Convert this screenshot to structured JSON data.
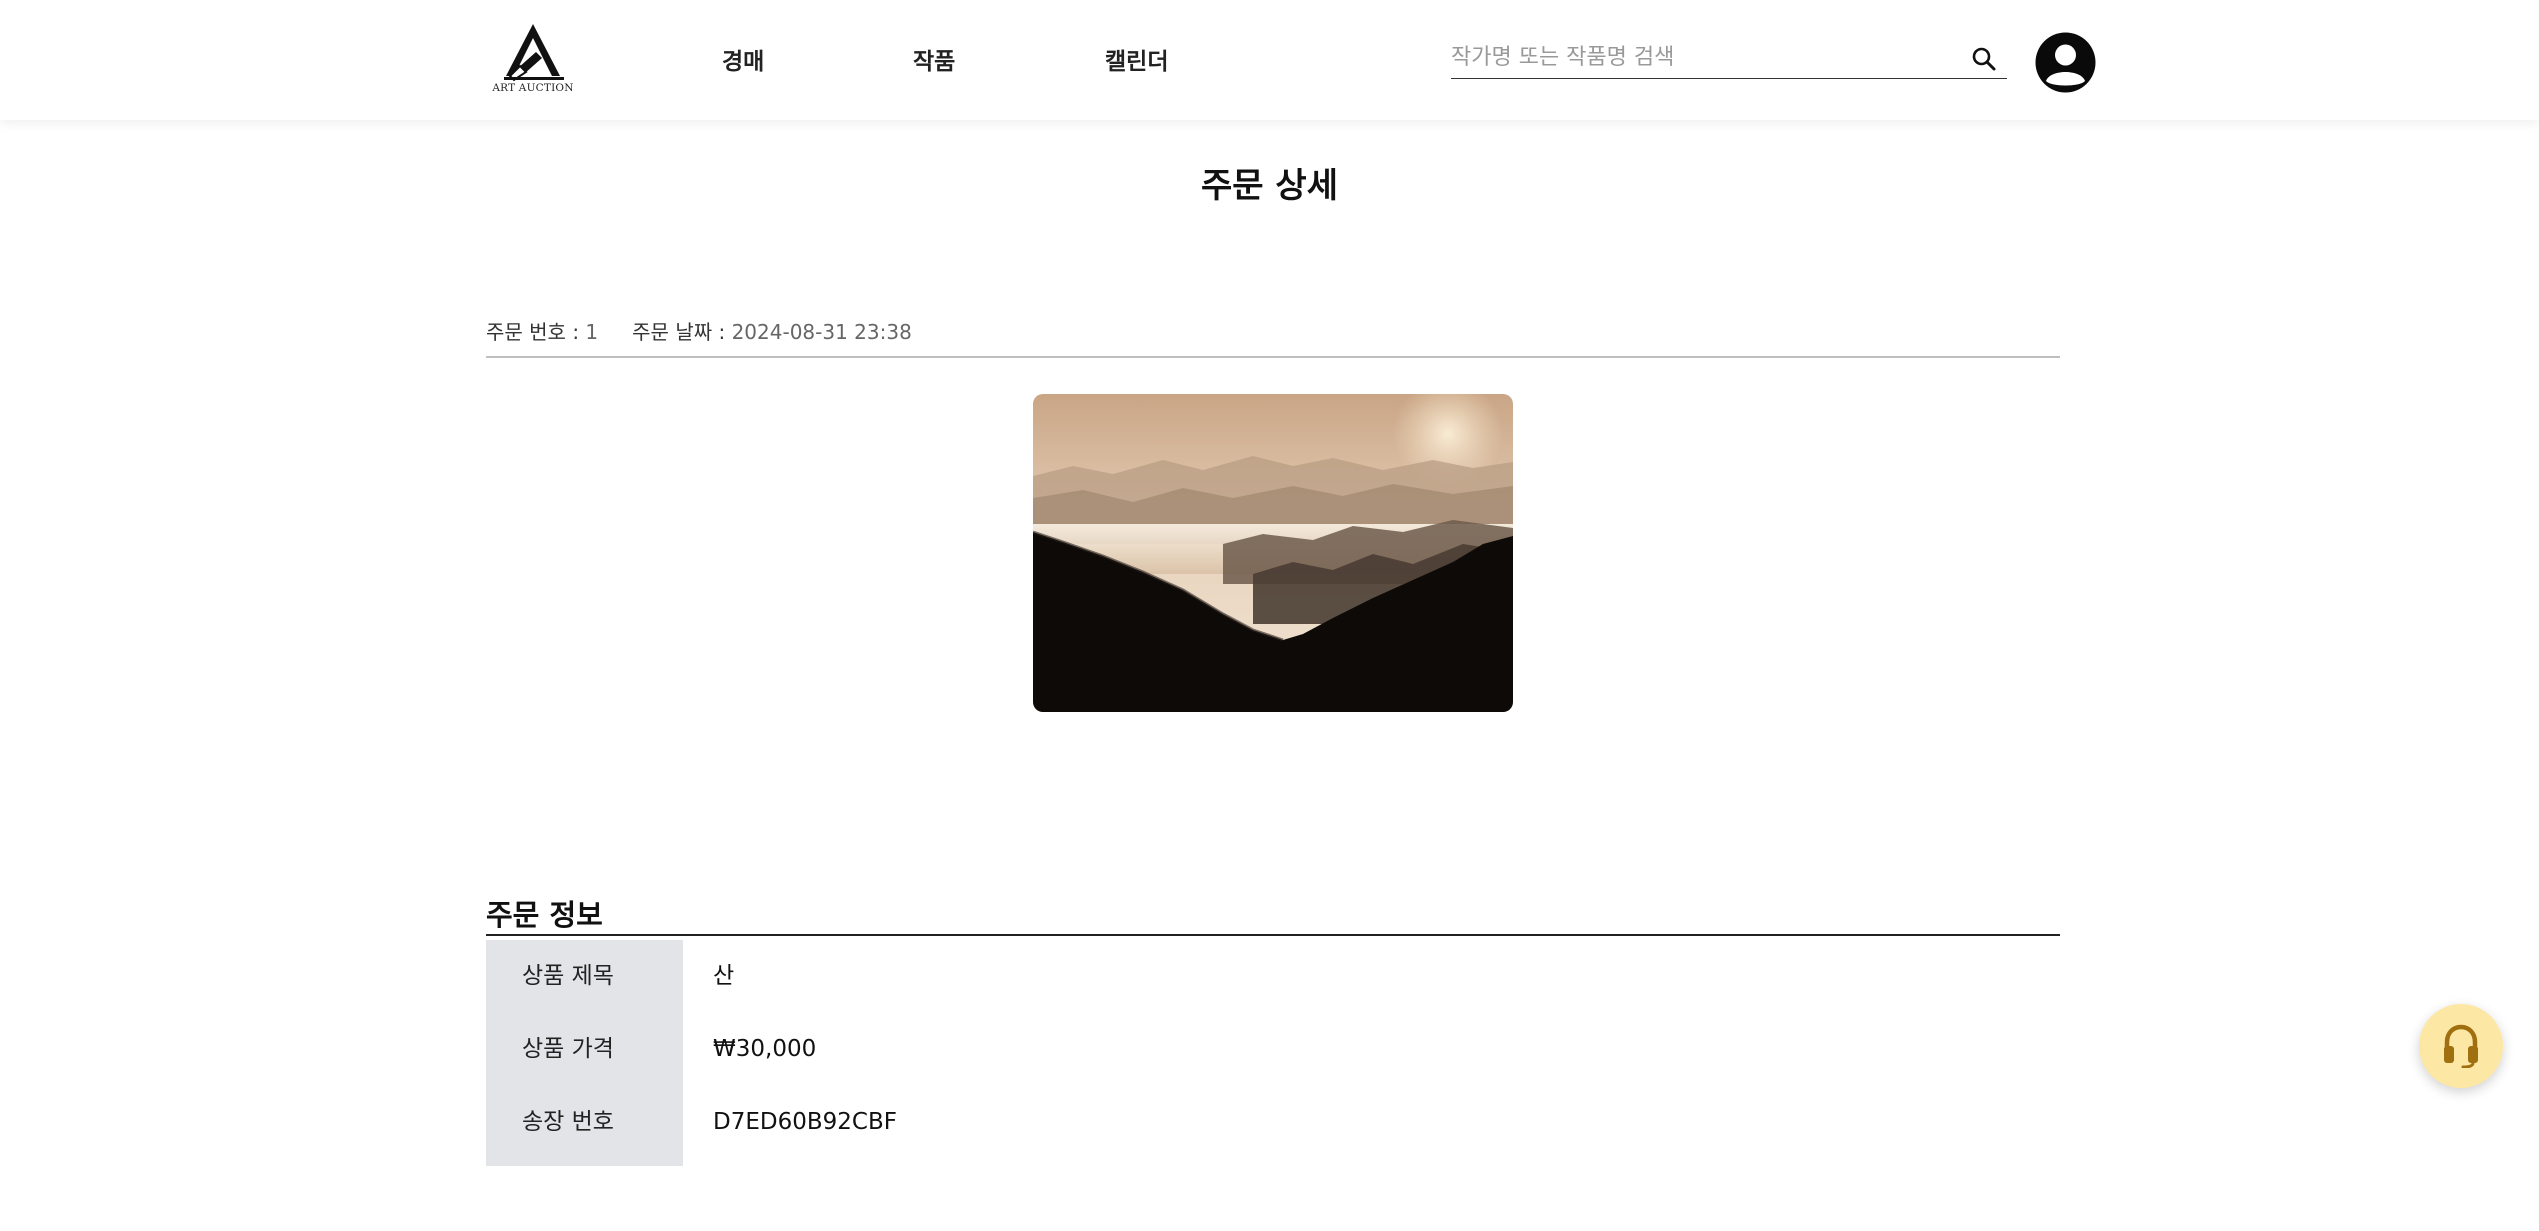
{
  "header": {
    "logo_text": "ART AUCTION",
    "nav": [
      {
        "label": "경매"
      },
      {
        "label": "작품"
      },
      {
        "label": "캘린더"
      }
    ],
    "search": {
      "placeholder": "작가명 또는 작품명 검색",
      "value": ""
    },
    "icons": {
      "search": "search-icon",
      "profile": "user-avatar-icon"
    }
  },
  "page": {
    "title": "주문 상세"
  },
  "order": {
    "number_label": "주문 번호 : ",
    "number_value": "1",
    "date_label": "주문 날짜 : ",
    "date_value": "2024-08-31 23:38"
  },
  "info": {
    "section_title": "주문 정보",
    "rows": [
      {
        "label": "상품 제목",
        "value": "산"
      },
      {
        "label": "상품 가격",
        "value": "₩30,000"
      },
      {
        "label": "송장 번호",
        "value": "D7ED60B92CBF"
      }
    ]
  },
  "support": {
    "icon": "headset-icon",
    "color": "#fde7a4",
    "icon_color": "#a07010"
  },
  "colors": {
    "label_bg": "#e3e4e8",
    "divider": "#bfbfbf"
  }
}
